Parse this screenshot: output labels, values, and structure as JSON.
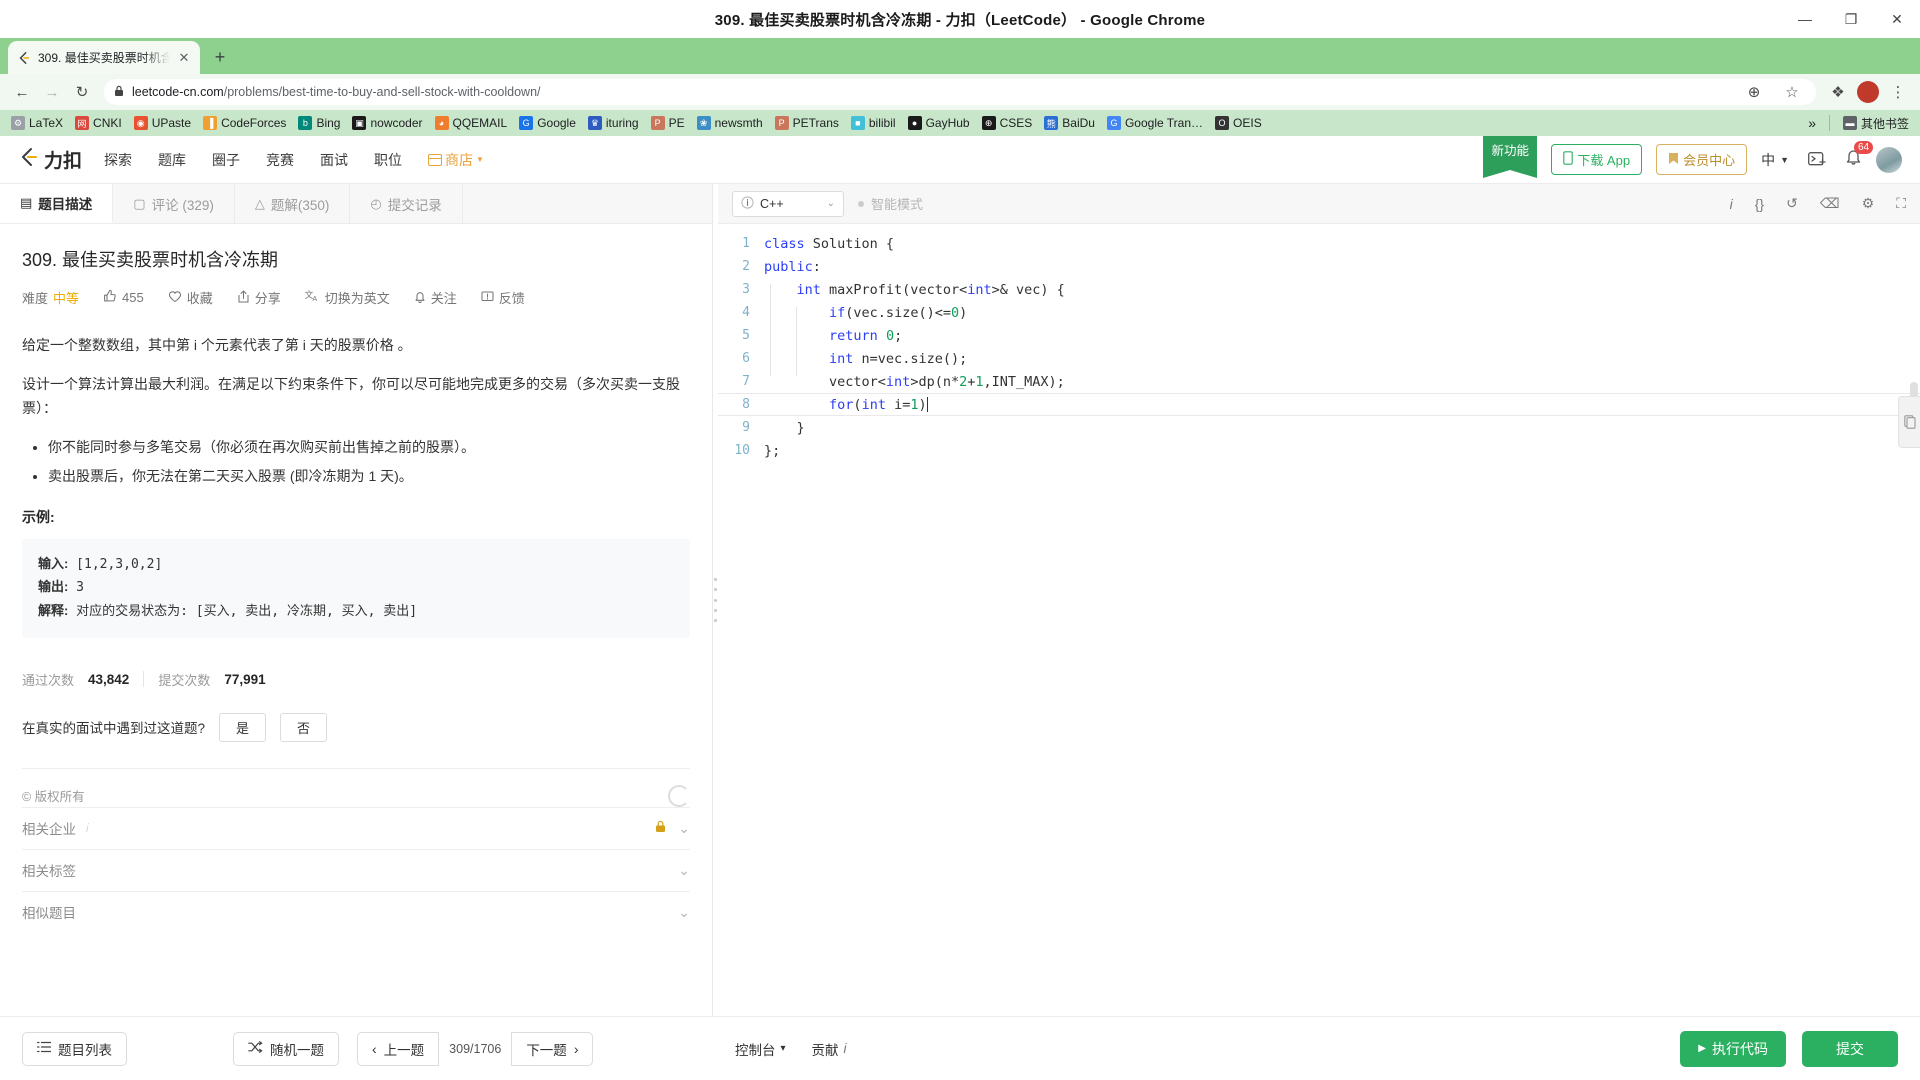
{
  "window": {
    "title": "309. 最佳买卖股票时机含冷冻期 - 力扣（LeetCode） - Google Chrome",
    "minimize": "—",
    "maximize": "❐",
    "close": "✕"
  },
  "browser": {
    "tab": {
      "title": "309. 最佳买卖股票时机含…",
      "close": "✕",
      "favicon": "leetcode-favicon"
    },
    "new_tab": "+",
    "back": "←",
    "forward": "→",
    "reload": "↻",
    "lock": "ὑ2",
    "url_domain": "leetcode-cn.com",
    "url_path": "/problems/best-time-to-buy-and-sell-stock-with-cooldown/",
    "zoom_icon": "⊕",
    "star_icon": "☆",
    "ext_icon": "❖",
    "profile_icon": "profile-avatar",
    "menu_icon": "⋮",
    "bookmarks": [
      {
        "label": "LaTeX",
        "icon": "latex-icon",
        "color": "#9aa0a6",
        "glyph": "⚙"
      },
      {
        "label": "CNKI",
        "icon": "cnki-icon",
        "color": "#d94a3d",
        "glyph": "网"
      },
      {
        "label": "UPaste",
        "icon": "upaste-icon",
        "color": "#e8522f",
        "glyph": "◉"
      },
      {
        "label": "CodeForces",
        "icon": "codeforces-icon",
        "color": "#f0a030",
        "glyph": "▐"
      },
      {
        "label": "Bing",
        "icon": "bing-icon",
        "color": "#00897b",
        "glyph": "b"
      },
      {
        "label": "nowcoder",
        "icon": "nowcoder-icon",
        "color": "#1a1a1a",
        "glyph": "▣"
      },
      {
        "label": "QQEMAIL",
        "icon": "qqmail-icon",
        "color": "#f07c2e",
        "glyph": "◕"
      },
      {
        "label": "Google",
        "icon": "google-icon",
        "color": "#1a73e8",
        "glyph": "G"
      },
      {
        "label": "ituring",
        "icon": "ituring-icon",
        "color": "#2d5bbf",
        "glyph": "♛"
      },
      {
        "label": "PE",
        "icon": "pe-icon",
        "color": "#c9765a",
        "glyph": "P"
      },
      {
        "label": "newsmth",
        "icon": "newsmth-icon",
        "color": "#3c8ec4",
        "glyph": "❀"
      },
      {
        "label": "PETrans",
        "icon": "petrans-icon",
        "color": "#c9765a",
        "glyph": "P"
      },
      {
        "label": "bilibil",
        "icon": "bilibili-icon",
        "color": "#41c0d8",
        "glyph": "■"
      },
      {
        "label": "GayHub",
        "icon": "github-icon",
        "color": "#1a1a1a",
        "glyph": "●"
      },
      {
        "label": "CSES",
        "icon": "cses-icon",
        "color": "#1a1a1a",
        "glyph": "⊕"
      },
      {
        "label": "BaiDu",
        "icon": "baidu-icon",
        "color": "#2a6fd8",
        "glyph": "熊"
      },
      {
        "label": "Google Tran…",
        "icon": "google-translate-icon",
        "color": "#4285f4",
        "glyph": "G"
      },
      {
        "label": "OEIS",
        "icon": "oeis-icon",
        "color": "#333333",
        "glyph": "O"
      }
    ],
    "overflow": "»",
    "other_bookmarks": {
      "label": "其他书签",
      "icon": "folder-icon",
      "glyph": "▬"
    }
  },
  "site_header": {
    "logo_text": "力扣",
    "nav": [
      {
        "label": "探索",
        "name": "explore"
      },
      {
        "label": "题库",
        "name": "problems"
      },
      {
        "label": "圈子",
        "name": "circle"
      },
      {
        "label": "竞赛",
        "name": "contest"
      },
      {
        "label": "面试",
        "name": "interview"
      },
      {
        "label": "职位",
        "name": "jobs"
      }
    ],
    "shop": "商店",
    "ribbon": "新功能",
    "download_app": "下载 App",
    "membership": "会员中心",
    "language": "中",
    "notification_count": "64",
    "terminal_icon": "terminal-plus-icon",
    "bell_icon": "bell-icon"
  },
  "left_pane": {
    "tabs": [
      {
        "label": "题目描述",
        "icon": "description-icon",
        "glyph": "▤",
        "active": true
      },
      {
        "label": "评论 (329)",
        "icon": "comment-icon",
        "glyph": "▢",
        "active": false
      },
      {
        "label": "题解(350)",
        "icon": "solution-icon",
        "glyph": "△",
        "active": false
      },
      {
        "label": "提交记录",
        "icon": "history-icon",
        "glyph": "◴",
        "active": false
      }
    ],
    "problem_title": "309. 最佳买卖股票时机含冷冻期",
    "meta": {
      "difficulty_label": "难度",
      "difficulty_value": "中等",
      "likes": "455",
      "likes_icon": "thumbs-up-icon",
      "favorite": "收藏",
      "favorite_icon": "heart-icon",
      "share": "分享",
      "share_icon": "share-icon",
      "switch_english": "切换为英文",
      "switch_icon": "translate-icon",
      "follow": "关注",
      "follow_icon": "bell-icon",
      "feedback": "反馈",
      "feedback_icon": "feedback-icon"
    },
    "description": {
      "p1": "给定一个整数数组，其中第 i 个元素代表了第 i 天的股票价格 。",
      "p2": "设计一个算法计算出最大利润。在满足以下约束条件下，你可以尽可能地完成更多的交易（多次买卖一支股票）：",
      "bullets": [
        "你不能同时参与多笔交易（你必须在再次购买前出售掉之前的股票）。",
        "卖出股票后，你无法在第二天买入股票 (即冷冻期为 1 天)。"
      ]
    },
    "example": {
      "label": "示例:",
      "input_label": "输入:",
      "input_value": "[1,2,3,0,2]",
      "output_label": "输出:",
      "output_value": "3",
      "explain_label": "解释:",
      "explain_value": "对应的交易状态为: [买入, 卖出, 冷冻期, 买入, 卖出]"
    },
    "stats": {
      "accepted_label": "通过次数",
      "accepted_value": "43,842",
      "submissions_label": "提交次数",
      "submissions_value": "77,991"
    },
    "ask": {
      "question": "在真实的面试中遇到过这道题?",
      "yes": "是",
      "no": "否"
    },
    "copyright": "© 版权所有",
    "accordions": [
      {
        "label": "相关企业",
        "name": "related-companies",
        "locked": true,
        "info": "i"
      },
      {
        "label": "相关标签",
        "name": "related-tags",
        "locked": false,
        "info": ""
      },
      {
        "label": "相似题目",
        "name": "similar-problems",
        "locked": false,
        "info": ""
      }
    ],
    "chevron": "⌄"
  },
  "editor": {
    "language": "C++",
    "language_info_icon": "info-icon",
    "chevron": "⌄",
    "smart_mode": "智能模式",
    "tools": [
      {
        "name": "info-icon",
        "glyph": "i"
      },
      {
        "name": "format-braces-icon",
        "glyph": "{}"
      },
      {
        "name": "reset-icon",
        "glyph": "↺"
      },
      {
        "name": "console-icon",
        "glyph": "⌫"
      },
      {
        "name": "settings-icon",
        "glyph": "⚙"
      },
      {
        "name": "fullscreen-icon",
        "glyph": "⛶"
      }
    ],
    "lines": [
      {
        "n": "1",
        "tokens": [
          {
            "t": "class ",
            "c": "kw"
          },
          {
            "t": "Solution {",
            "c": ""
          }
        ]
      },
      {
        "n": "2",
        "tokens": [
          {
            "t": "public",
            "c": "kw"
          },
          {
            "t": ":",
            "c": ""
          }
        ]
      },
      {
        "n": "3",
        "tokens": [
          {
            "t": "    ",
            "c": ""
          },
          {
            "t": "int",
            "c": "ty"
          },
          {
            "t": " maxProfit(vector<",
            "c": ""
          },
          {
            "t": "int",
            "c": "ty"
          },
          {
            "t": ">& vec) {",
            "c": ""
          }
        ]
      },
      {
        "n": "4",
        "tokens": [
          {
            "t": "        ",
            "c": ""
          },
          {
            "t": "if",
            "c": "kw"
          },
          {
            "t": "(vec.size()<=",
            "c": ""
          },
          {
            "t": "0",
            "c": "num"
          },
          {
            "t": ")",
            "c": ""
          }
        ]
      },
      {
        "n": "5",
        "tokens": [
          {
            "t": "        ",
            "c": ""
          },
          {
            "t": "return",
            "c": "kw"
          },
          {
            "t": " ",
            "c": ""
          },
          {
            "t": "0",
            "c": "num"
          },
          {
            "t": ";",
            "c": ""
          }
        ]
      },
      {
        "n": "6",
        "tokens": [
          {
            "t": "        ",
            "c": ""
          },
          {
            "t": "int",
            "c": "ty"
          },
          {
            "t": " n=vec.size();",
            "c": ""
          }
        ]
      },
      {
        "n": "7",
        "tokens": [
          {
            "t": "        vector<",
            "c": ""
          },
          {
            "t": "int",
            "c": "ty"
          },
          {
            "t": ">dp(n*",
            "c": ""
          },
          {
            "t": "2",
            "c": "num"
          },
          {
            "t": "+",
            "c": ""
          },
          {
            "t": "1",
            "c": "num"
          },
          {
            "t": ",INT_MAX);",
            "c": ""
          }
        ]
      },
      {
        "n": "8",
        "tokens": [
          {
            "t": "        ",
            "c": ""
          },
          {
            "t": "for",
            "c": "kw"
          },
          {
            "t": "(",
            "c": ""
          },
          {
            "t": "int",
            "c": "ty"
          },
          {
            "t": " i=",
            "c": ""
          },
          {
            "t": "1",
            "c": "num"
          },
          {
            "t": ")",
            "c": ""
          }
        ],
        "current": true
      },
      {
        "n": "9",
        "tokens": [
          {
            "t": "    }",
            "c": ""
          }
        ]
      },
      {
        "n": "10",
        "tokens": [
          {
            "t": "};",
            "c": ""
          }
        ]
      }
    ]
  },
  "bottom_bar": {
    "problem_list": "题目列表",
    "problem_list_icon": "list-icon",
    "random": "随机一题",
    "random_icon": "shuffle-icon",
    "prev": "上一题",
    "prev_icon": "chevron-left-icon",
    "page_count": "309/1706",
    "next": "下一题",
    "next_icon": "chevron-right-icon",
    "console": "控制台",
    "console_chevron": "▾",
    "contribute": "贡献",
    "contribute_info": "i",
    "run": "执行代码",
    "run_icon": "play-icon",
    "submit": "提交"
  },
  "colors": {
    "brand_green": "#2bb062",
    "medium_orange": "#f0ad00",
    "chrome_green": "#8ed18e",
    "badge_red": "#e94b4b"
  }
}
